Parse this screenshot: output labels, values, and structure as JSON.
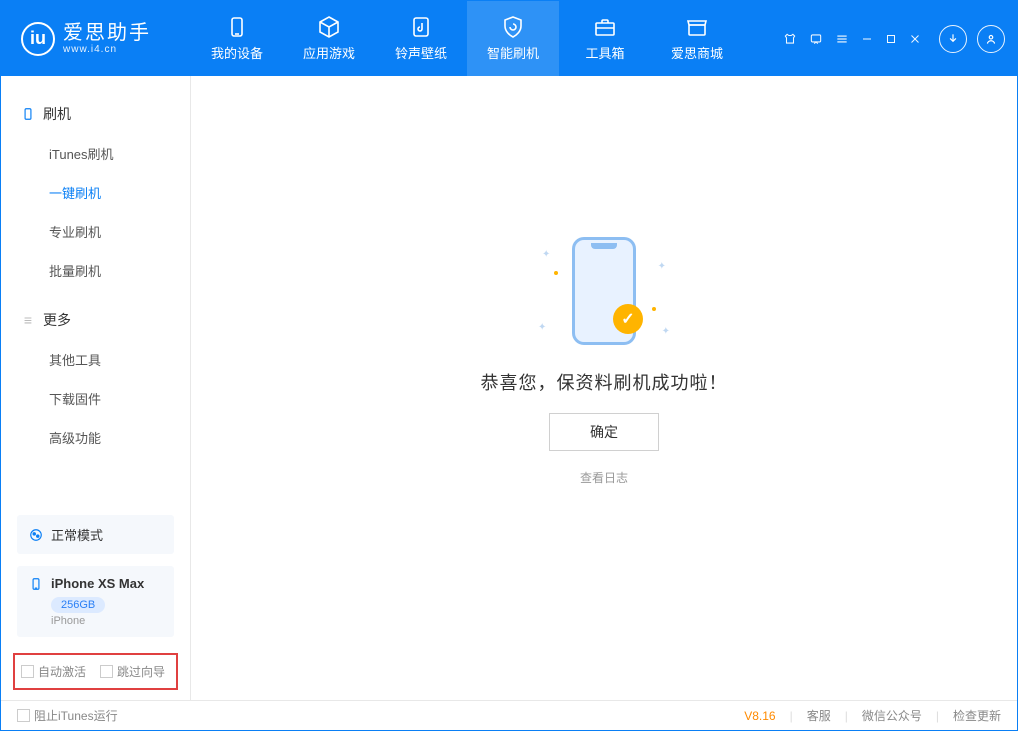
{
  "logo": {
    "title": "爱思助手",
    "sub": "www.i4.cn"
  },
  "nav": {
    "tabs": [
      {
        "label": "我的设备"
      },
      {
        "label": "应用游戏"
      },
      {
        "label": "铃声壁纸"
      },
      {
        "label": "智能刷机"
      },
      {
        "label": "工具箱"
      },
      {
        "label": "爱思商城"
      }
    ]
  },
  "sidebar": {
    "section1_title": "刷机",
    "items1": [
      {
        "label": "iTunes刷机"
      },
      {
        "label": "一键刷机"
      },
      {
        "label": "专业刷机"
      },
      {
        "label": "批量刷机"
      }
    ],
    "section2_title": "更多",
    "items2": [
      {
        "label": "其他工具"
      },
      {
        "label": "下载固件"
      },
      {
        "label": "高级功能"
      }
    ],
    "mode_label": "正常模式",
    "device_name": "iPhone XS Max",
    "device_storage": "256GB",
    "device_type": "iPhone",
    "cb_auto_activate": "自动激活",
    "cb_skip_guide": "跳过向导"
  },
  "content": {
    "success_msg": "恭喜您，保资料刷机成功啦！",
    "ok_btn": "确定",
    "log_link": "查看日志"
  },
  "footer": {
    "block_itunes": "阻止iTunes运行",
    "version": "V8.16",
    "links": [
      {
        "label": "客服"
      },
      {
        "label": "微信公众号"
      },
      {
        "label": "检查更新"
      }
    ]
  }
}
